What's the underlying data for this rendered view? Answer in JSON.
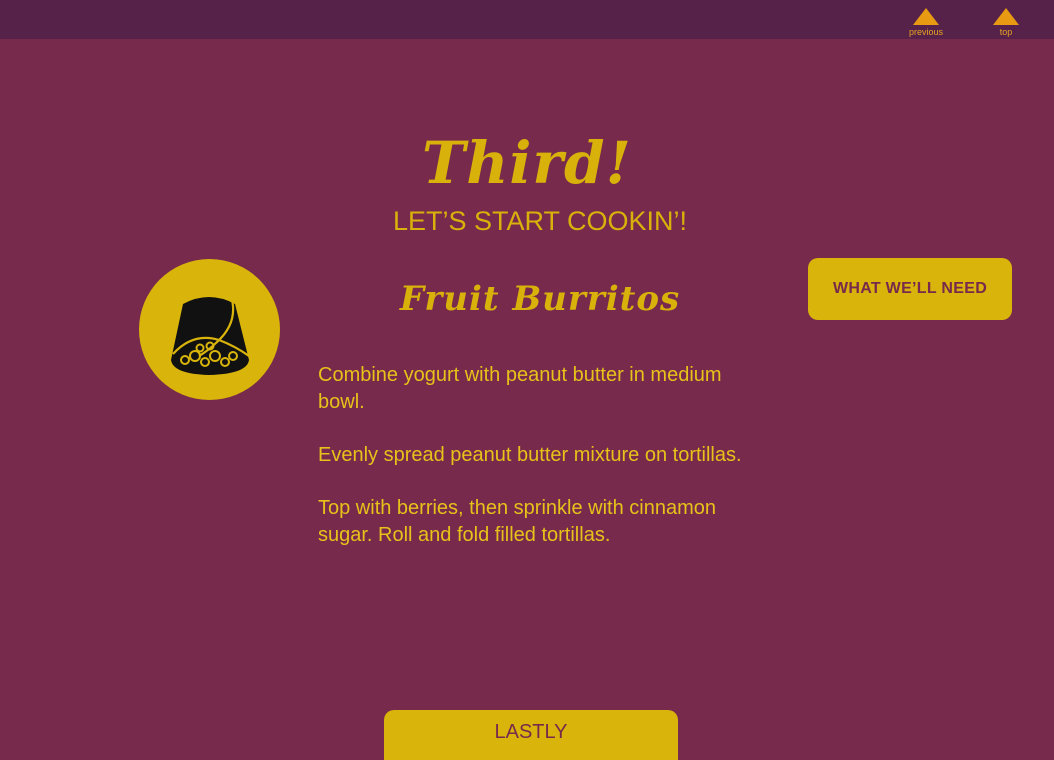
{
  "nav": {
    "previous_label": "previous",
    "top_label": "top"
  },
  "section": {
    "heading": "Third!",
    "subheading": "LET’S START COOKIN’!"
  },
  "recipe": {
    "title": "Fruit Burritos",
    "icon": "burrito-icon",
    "steps": [
      "Combine yogurt with peanut butter in medium bowl.",
      "Evenly spread peanut butter mixture on tortillas.",
      "Top with berries, then sprinkle with cinnamon sugar. Roll and fold filled tortillas."
    ]
  },
  "buttons": {
    "need_label": "WHAT WE’LL NEED",
    "lastly_label": "LASTLY"
  },
  "colors": {
    "background": "#772a4b",
    "topbar": "#562249",
    "accent": "#d9b40b",
    "nav_arrow": "#e89a12"
  }
}
